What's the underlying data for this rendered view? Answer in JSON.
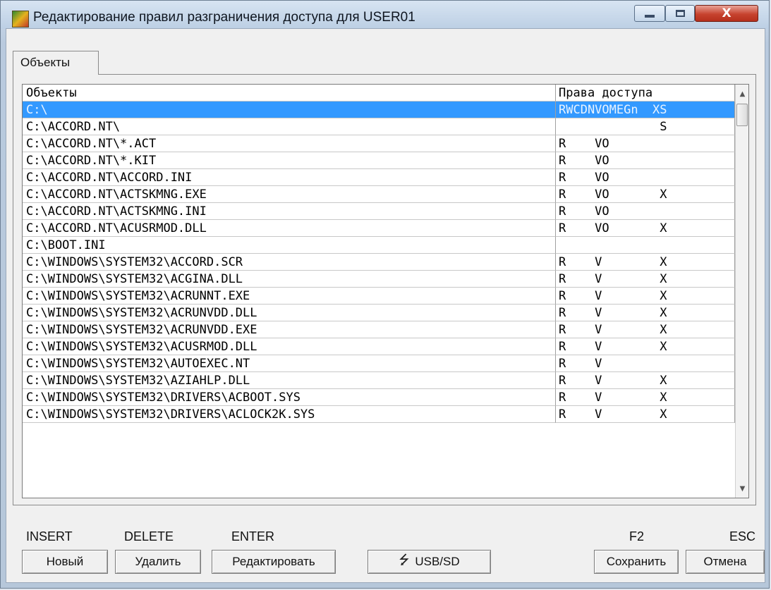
{
  "window": {
    "title": "Редактирование правил разграничения доступа для USER01",
    "close_glyph": "X"
  },
  "tabs": [
    {
      "label": "Объекты",
      "active": true
    }
  ],
  "grid": {
    "columns": [
      "Объекты",
      "Права доступа"
    ],
    "rows": [
      {
        "object": "C:\\",
        "rights": "RWCDNVOMEGn  XS",
        "selected": true
      },
      {
        "object": "C:\\ACCORD.NT\\",
        "rights": "              S"
      },
      {
        "object": "C:\\ACCORD.NT\\*.ACT",
        "rights": "R    VO"
      },
      {
        "object": "C:\\ACCORD.NT\\*.KIT",
        "rights": "R    VO"
      },
      {
        "object": "C:\\ACCORD.NT\\ACCORD.INI",
        "rights": "R    VO"
      },
      {
        "object": "C:\\ACCORD.NT\\ACTSKMNG.EXE",
        "rights": "R    VO       X"
      },
      {
        "object": "C:\\ACCORD.NT\\ACTSKMNG.INI",
        "rights": "R    VO"
      },
      {
        "object": "C:\\ACCORD.NT\\ACUSRMOD.DLL",
        "rights": "R    VO       X"
      },
      {
        "object": "C:\\BOOT.INI",
        "rights": ""
      },
      {
        "object": "C:\\WINDOWS\\SYSTEM32\\ACCORD.SCR",
        "rights": "R    V        X"
      },
      {
        "object": "C:\\WINDOWS\\SYSTEM32\\ACGINA.DLL",
        "rights": "R    V        X"
      },
      {
        "object": "C:\\WINDOWS\\SYSTEM32\\ACRUNNT.EXE",
        "rights": "R    V        X"
      },
      {
        "object": "C:\\WINDOWS\\SYSTEM32\\ACRUNVDD.DLL",
        "rights": "R    V        X"
      },
      {
        "object": "C:\\WINDOWS\\SYSTEM32\\ACRUNVDD.EXE",
        "rights": "R    V        X"
      },
      {
        "object": "C:\\WINDOWS\\SYSTEM32\\ACUSRMOD.DLL",
        "rights": "R    V        X"
      },
      {
        "object": "C:\\WINDOWS\\SYSTEM32\\AUTOEXEC.NT",
        "rights": "R    V"
      },
      {
        "object": "C:\\WINDOWS\\SYSTEM32\\AZIAHLP.DLL",
        "rights": "R    V        X"
      },
      {
        "object": "C:\\WINDOWS\\SYSTEM32\\DRIVERS\\ACBOOT.SYS",
        "rights": "R    V        X"
      },
      {
        "object": "C:\\WINDOWS\\SYSTEM32\\DRIVERS\\ACLOCK2K.SYS",
        "rights": "R    V        X"
      }
    ]
  },
  "keys": {
    "insert": "INSERT",
    "delete": "DELETE",
    "enter": "ENTER",
    "f2": "F2",
    "esc": "ESC"
  },
  "buttons": {
    "new": "Новый",
    "delete": "Удалить",
    "edit": "Редактировать",
    "usb": "USB/SD",
    "save": "Сохранить",
    "cancel": "Отмена"
  },
  "colors": {
    "selection": "#3399ff",
    "close_button": "#c7432f"
  },
  "icons": {
    "usb": "usb-icon",
    "app": "accord-app-icon"
  }
}
